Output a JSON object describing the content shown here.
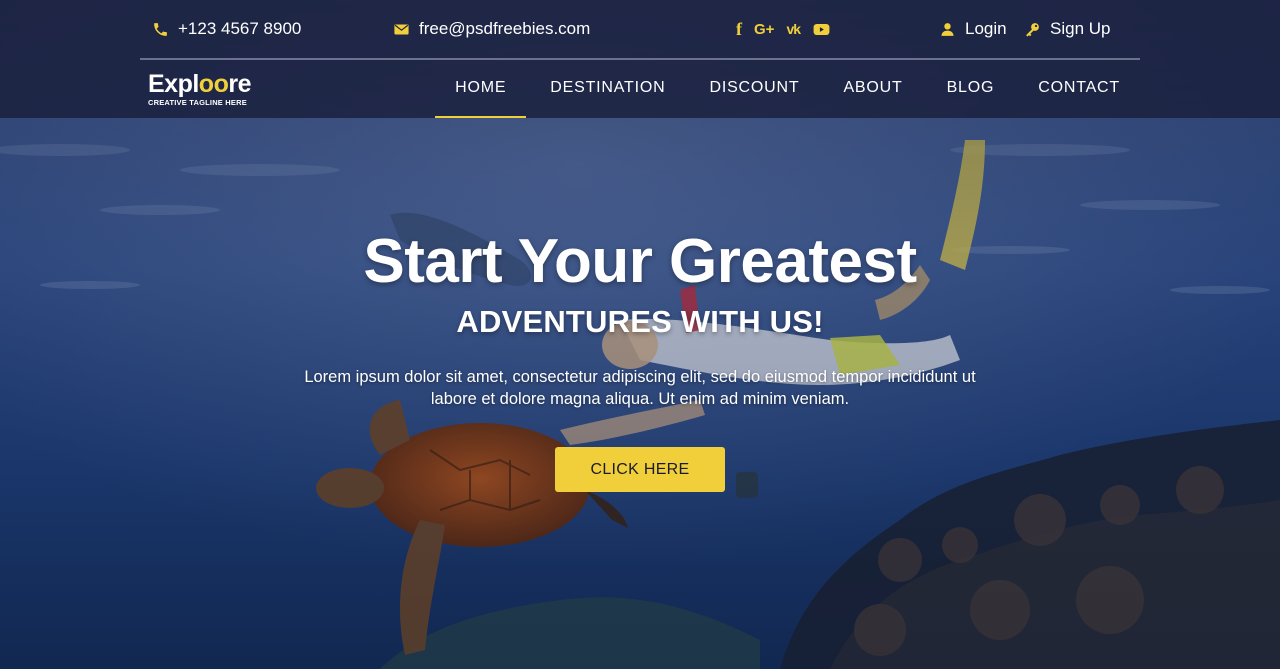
{
  "topbar": {
    "phone": "+123 4567 8900",
    "email": "free@psdfreebies.com",
    "social": [
      {
        "name": "facebook-icon",
        "glyph": "f"
      },
      {
        "name": "google-plus-icon",
        "glyph": "G+"
      },
      {
        "name": "vk-icon",
        "glyph": "vk"
      },
      {
        "name": "youtube-icon",
        "glyph": "yt"
      }
    ],
    "login": "Login",
    "signup": "Sign Up"
  },
  "logo": {
    "name_start": "Expl",
    "name_highlight": "oo",
    "name_end": "re",
    "tagline": "CREATIVE TAGLINE HERE"
  },
  "nav": {
    "items": [
      "HOME",
      "DESTINATION",
      "DISCOUNT",
      "ABOUT",
      "BLOG",
      "CONTACT"
    ],
    "active": "HOME"
  },
  "hero": {
    "title": "Start Your Greatest",
    "subtitle": "ADVENTURES WITH US!",
    "description": "Lorem ipsum dolor sit amet, consectetur adipiscing elit, sed do eiusmod tempor incididunt ut labore et dolore magna aliqua. Ut enim ad minim veniam.",
    "cta": "CLICK HERE"
  },
  "colors": {
    "accent": "#f0cf3a",
    "header_bg": "#1a1e3c",
    "text": "#ffffff"
  }
}
